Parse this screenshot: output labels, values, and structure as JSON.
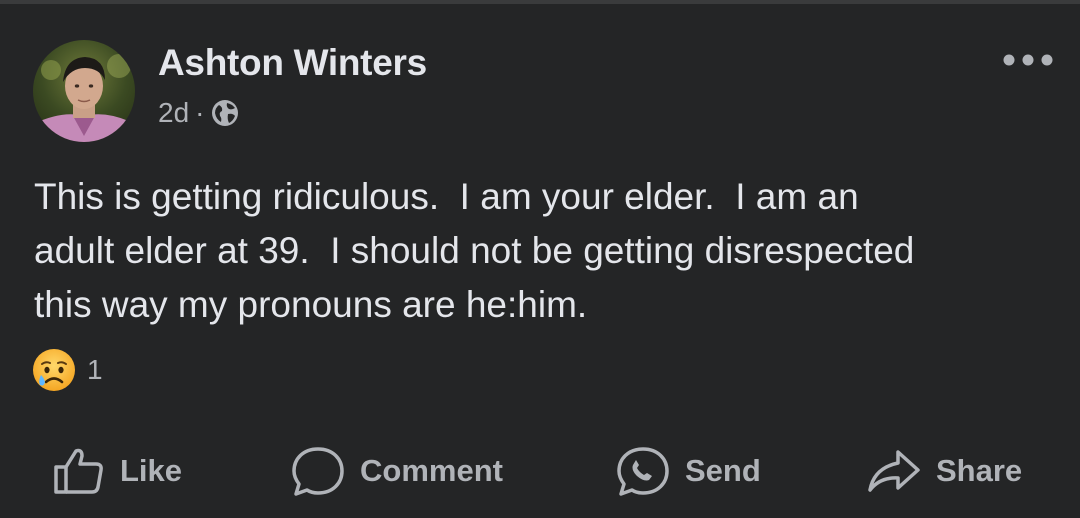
{
  "post": {
    "author": "Ashton Winters",
    "time": "2d",
    "separator": "·",
    "privacy_icon": "globe-icon",
    "text": "This is getting ridiculous.  I am your elder.  I am an\nadult elder at 39.  I should not be getting disrespected\nthis way my pronouns are he:him.",
    "reactions": {
      "icon": "sad-reaction-icon",
      "count": "1"
    }
  },
  "actions": {
    "like": "Like",
    "comment": "Comment",
    "send": "Send",
    "share": "Share"
  },
  "colors": {
    "background": "#242526",
    "primary_text": "#e4e6eb",
    "secondary_text": "#b0b3b8"
  }
}
